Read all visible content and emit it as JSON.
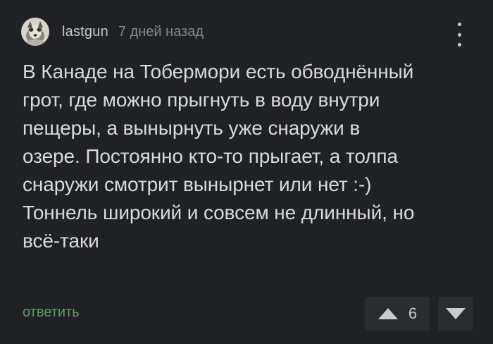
{
  "comment": {
    "author": "lastgun",
    "timestamp": "7 дней назад",
    "text": "В Канаде на Тобермори есть обводнённый\nгрот, где можно прыгнуть в воду внутри\nпещеры, а вынырнуть уже снаружи в\nозере. Постоянно кто-то прыгает, а толпа\nснаружи смотрит вынырнет или нет :-)\nТоннель широкий и совсем не длинный, но\nвсё-таки",
    "reply_label": "ответить",
    "rating": "6"
  },
  "icons": {
    "avatar": "dog-avatar",
    "menu": "more-vertical-icon",
    "upvote": "triangle-up-icon",
    "downvote": "triangle-down-icon"
  },
  "colors": {
    "background": "#1f2124",
    "text": "#d9dadc",
    "muted": "#85878a",
    "reply": "#5f9a6c",
    "button_bg": "#2a2d30"
  }
}
